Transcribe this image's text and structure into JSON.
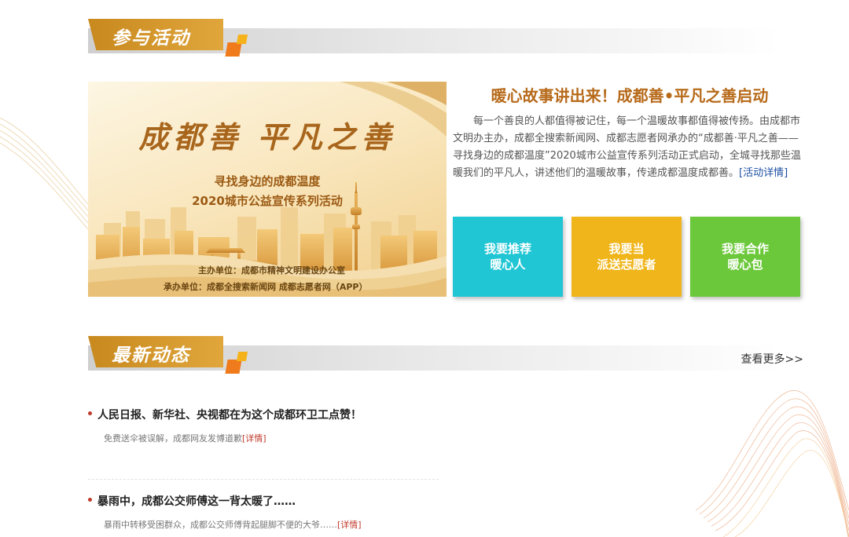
{
  "sections": {
    "activity_title": "参与活动",
    "news_title": "最新动态",
    "news_more": "查看更多>>"
  },
  "banner": {
    "title": "成都善 平凡之善",
    "subtitle1": "寻找身边的成都温度",
    "subtitle2": "2020城市公益宣传系列活动",
    "organizer": "主办单位：成都市精神文明建设办公室",
    "co_organizer": "承办单位：成都全搜索新闻网   成都志愿者网（APP）"
  },
  "activity": {
    "headline": "暖心故事讲出来！成都善•平凡之善启动",
    "body": "每一个善良的人都值得被记住，每一个温暖故事都值得被传扬。由成都市文明办主办，成都全搜索新闻网、成都志愿者网承办的“成都善·平凡之善——寻找身边的成都温度”2020城市公益宣传系列活动正式启动，全城寻找那些温暖我们的平凡人，讲述他们的温暖故事，传递成都温度成都善。",
    "detail_link": "[活动详情]"
  },
  "buttons": [
    {
      "line1": "我要推荐",
      "line2": "暖心人"
    },
    {
      "line1": "我要当",
      "line2": "派送志愿者"
    },
    {
      "line1": "我要合作",
      "line2": "暖心包"
    }
  ],
  "news": [
    {
      "title": "人民日报、新华社、央视都在为这个成都环卫工点赞！",
      "desc": "免费送伞被误解，成都网友发博道歉",
      "link": "[详情]"
    },
    {
      "title": "暴雨中，成都公交师傅这一背太暖了……",
      "desc": "暴雨中转移受困群众，成都公交师傅背起腿脚不便的大爷……",
      "link": "[详情]"
    }
  ],
  "colors": {
    "accent_gold": "#d9992e",
    "cyan": "#20c6d4",
    "yellow": "#f0b51a",
    "green": "#6cc83b",
    "headline": "#b76a1a"
  }
}
